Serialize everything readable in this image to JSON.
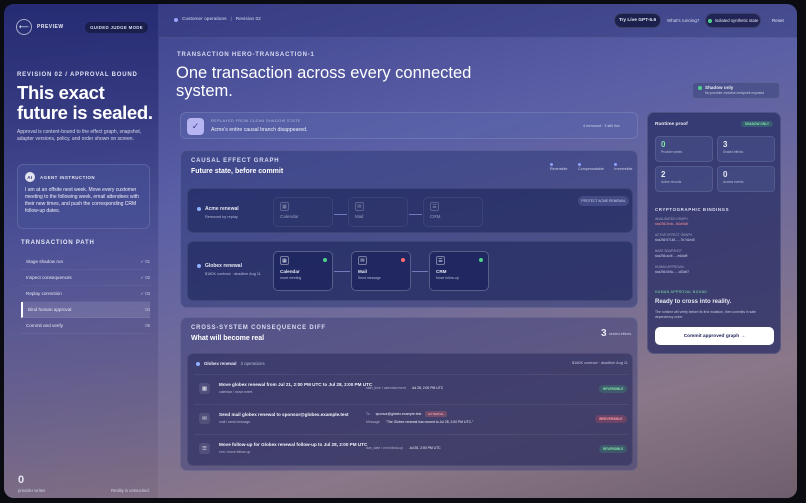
{
  "sidebar": {
    "logo_glyph": "⟵",
    "preview_label": "PREVIEW",
    "mode_label": "GUIDED JUDGE MODE",
    "kicker": "REVISION 02 / APPROVAL BOUND",
    "title": "This exact future is sealed.",
    "description": "Approval is content-bound to the effect graph, snapshot, adapter versions, policy, and order shown on screen.",
    "agent": {
      "badge": "AI",
      "heading": "AGENT INSTRUCTION",
      "text": "I am at an offsite next week. Move every customer meeting to the following week, email attendees with their new times, and push the corresponding CRM follow-up dates."
    },
    "path_label": "TRANSACTION PATH",
    "path": [
      {
        "label": "Stage shadow run",
        "num": "✓ 01"
      },
      {
        "label": "Inspect consequences",
        "num": "✓ 02"
      },
      {
        "label": "Replay correction",
        "num": "✓ 03"
      },
      {
        "label": "Bind human approval",
        "num": "04"
      },
      {
        "label": "Commit and verify",
        "num": "05"
      }
    ],
    "count": "0",
    "count_label": "provider writes",
    "reality": "Reality is untouched."
  },
  "topbar": {
    "crumb1": "Customer operations",
    "crumb2": "Revision 02",
    "try_btn": "Try Live GPT-5.6",
    "whats": "What's running?",
    "isolated": "Isolated synthetic state",
    "reset": "Reset"
  },
  "hero": {
    "kicker": "TRANSACTION HERO-TRANSACTION-1",
    "title": "One transaction across every connected system.",
    "shadow_title": "Shadow only",
    "shadow_sub": "No provider mutation endpoint exposed"
  },
  "replay": {
    "kicker": "REPLAYED FROM CLEAN SHADOW STATE",
    "text": "Acme's entire causal branch disappeared.",
    "meta": "4 removed · 3 still live"
  },
  "causal": {
    "kicker": "CAUSAL EFFECT GRAPH",
    "title": "Future state, before commit",
    "legend": [
      "Reversible",
      "Compensatable",
      "Irreversible"
    ],
    "acme": {
      "label": "Acme renewal",
      "sub": "Removed by replay",
      "protect": "PROTECT ACME RENEWAL",
      "nodes": [
        {
          "icon": "▦",
          "name": "Calendar",
          "sub": "event"
        },
        {
          "icon": "✉",
          "name": "Mail",
          "sub": "message"
        },
        {
          "icon": "☰",
          "name": "CRM",
          "sub": "follow-up"
        }
      ]
    },
    "globex": {
      "label": "Globex renewal",
      "sub": "$180K contract · deadline Aug 11",
      "nodes": [
        {
          "icon": "▦",
          "name": "Calendar",
          "sub": "move meeting",
          "led": "#4fd38a"
        },
        {
          "icon": "✉",
          "name": "Mail",
          "sub": "Send message",
          "led": "#ff6b6b"
        },
        {
          "icon": "☰",
          "name": "CRM",
          "sub": "Move follow-up",
          "led": "#4fd38a"
        }
      ]
    }
  },
  "diff": {
    "kicker": "CROSS-SYSTEM CONSEQUENCE DIFF",
    "title": "What will become real",
    "count": "3",
    "count_label": "sealed effects",
    "group_label": "Globex renewal",
    "group_count": "3 operations",
    "group_right": "$180K contract · deadline Aug 11",
    "ops": [
      {
        "icon": "▦",
        "title": "Move globex renewal from Jul 21, 2:00 PM UTC to Jul 28, 2:00 PM UTC",
        "sub": "calendar / move.event",
        "k": "start_time / calendar.event",
        "v": "Jul 28, 2:00 PM UTC",
        "badge": "REVERSIBLE",
        "kind": "rev"
      },
      {
        "icon": "✉",
        "title": "Send mail globex renewal to sponsor@globex.example.test",
        "sub": "mail / send.message",
        "k": "To",
        "v": "sponsor@globex.example.test",
        "ext": "EXTERNAL",
        "k2": "Message",
        "v2": "\"The Globex renewal has moved to Jul 28, 2:00 PM UTC.\"",
        "badge": "IRREVERSIBLE",
        "kind": "irr"
      },
      {
        "icon": "☰",
        "title": "Move follow-up for Globex renewal follow-up to Jul 28, 2:00 PM UTC",
        "sub": "crm / move.follow-up",
        "k": "due_date / crm.follow-up",
        "v": "Jul 28, 2:00 PM UTC",
        "badge": "REVERSIBLE",
        "kind": "rev"
      }
    ]
  },
  "proof": {
    "title": "Runtime proof",
    "shadow_only": "SHADOW ONLY",
    "stats": [
      {
        "value": "0",
        "label": "Provider writes"
      },
      {
        "value": "3",
        "label": "Sealed effects"
      },
      {
        "value": "2",
        "label": "Active records"
      },
      {
        "value": "0",
        "label": "Access events"
      }
    ],
    "bindings_label": "CRYPTOGRAPHIC BINDINGS",
    "bindings": [
      {
        "label": "INVALIDATED GRAPH",
        "value": "sha256:2edc...fb2a9d4f"
      },
      {
        "label": "ACTIVE EFFECT GRAPH",
        "value": "sha256:97148......7b7d1e45"
      },
      {
        "label": "BASE SNAPSHOT",
        "value": "sha256:ac0f......e6da9f"
      },
      {
        "label": "HUMAN APPROVAL",
        "value": "sha256:0b5c......c83a97"
      }
    ],
    "approval_kicker": "HUMAN APPROVAL BOUND",
    "ready": "Ready to cross into reality.",
    "ready_desc": "The runtime will verify before its first mutation, then commits in safe dependency order.",
    "commit": "Commit approved graph  →"
  }
}
